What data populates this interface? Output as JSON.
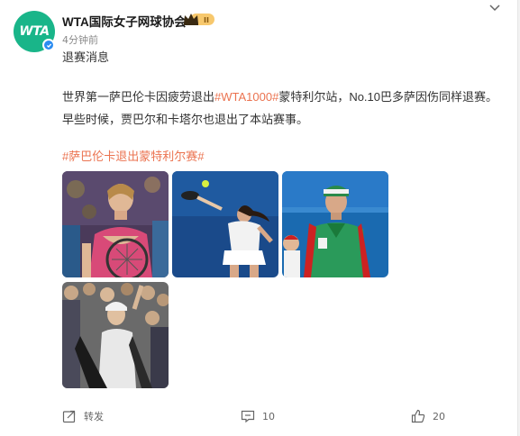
{
  "post": {
    "author": "WTA国际女子网球协会",
    "avatar_text": "WTA",
    "time": "4分钟前",
    "headline": "退赛消息",
    "body_parts": [
      {
        "text": "世界第一萨巴伦卡因疲劳退出",
        "tag": false
      },
      {
        "text": "#WTA1000#",
        "tag": true
      },
      {
        "text": "蒙特利尔站，No.10巴多萨因伤同样退赛。早些时候，贾巴尔和卡塔尔也退出了本站赛事。",
        "tag": false
      }
    ],
    "hashtag": "#萨巴伦卡退出蒙特利尔赛#",
    "badge_level": "II"
  },
  "photos": [
    {
      "name": "photo-sabalenka"
    },
    {
      "name": "photo-serve-player"
    },
    {
      "name": "photo-jabeur"
    },
    {
      "name": "photo-crowd-player"
    }
  ],
  "actions": {
    "repost_label": "转发",
    "comment_count": "10",
    "like_count": "20"
  },
  "icons": {
    "repost": "repost-icon",
    "comment": "comment-icon",
    "like": "like-icon",
    "more": "chevron-down-icon"
  },
  "colors": {
    "brand": "#19b589",
    "tag": "#eb7350",
    "verified": "#2b8cf1"
  }
}
